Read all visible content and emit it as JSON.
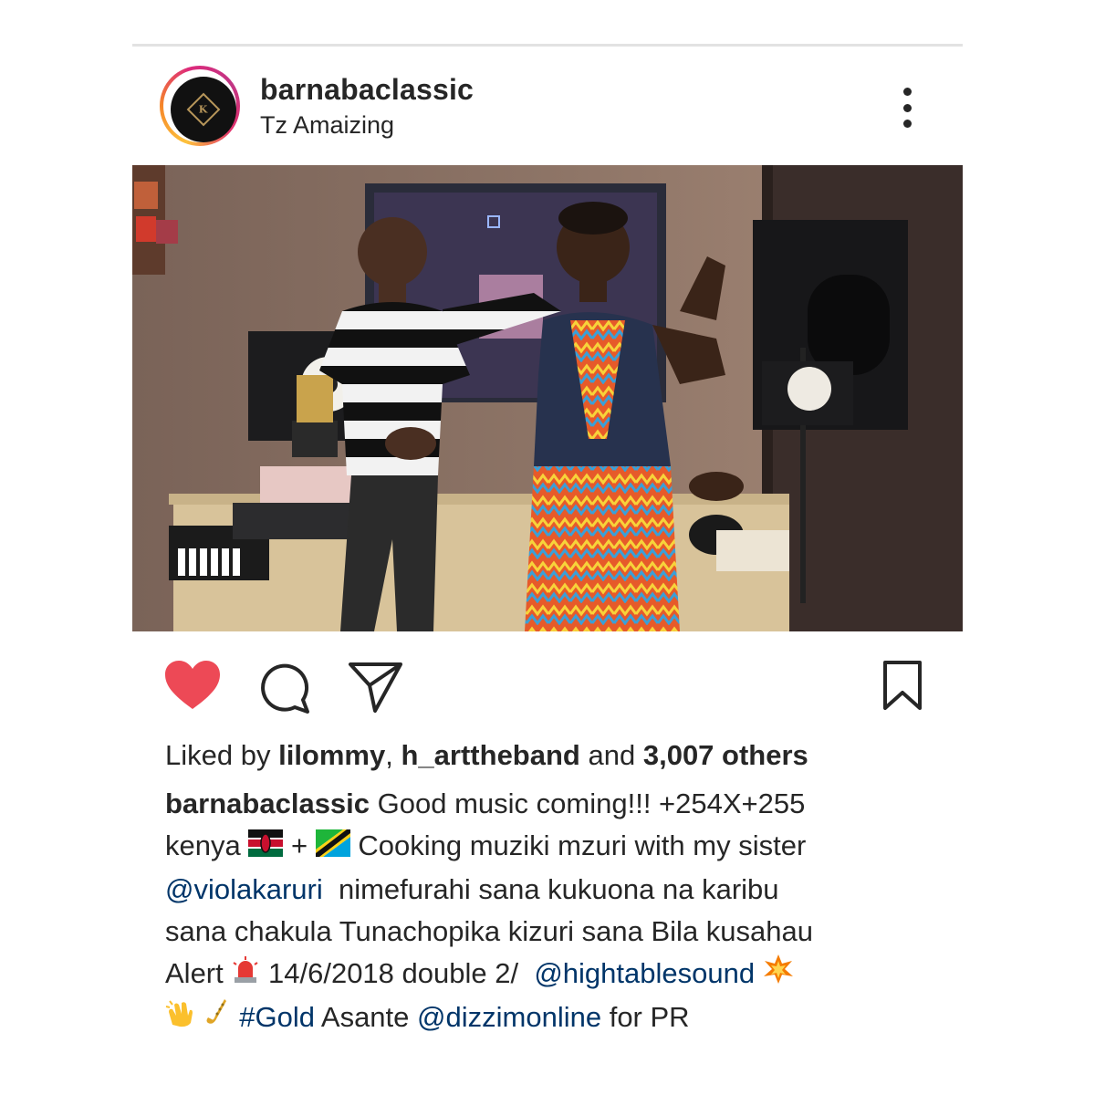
{
  "post": {
    "username": "barnabaclassic",
    "location": "Tz Amaizing",
    "avatar_monogram": "K"
  },
  "actions": {
    "like_icon": "heart-filled-icon",
    "comment_icon": "comment-icon",
    "share_icon": "send-icon",
    "save_icon": "bookmark-icon",
    "like_color": "#ed4956"
  },
  "likes": {
    "prefix": "Liked by",
    "user1": "lilommy",
    "sep": ",",
    "user2": "h_arttheband",
    "and": "and",
    "count": "3,007 others"
  },
  "caption": {
    "author": "barnabaclassic",
    "t1": "Good music coming!!! +254X+255",
    "t2": "kenya",
    "t3": "+",
    "t4": "Cooking muziki mzuri with my sister",
    "mention1": "@violakaruri",
    "t5": "nimefurahi sana kukuona na karibu",
    "t6": "sana chakula Tunachopika kizuri sana Bila kusahau",
    "t7": "Alert",
    "t8": "14/6/2018 double 2/",
    "mention2": "@hightablesound",
    "hashtag": "#Gold",
    "t9": "Asante",
    "mention3": "@dizzimonline",
    "t10": "for PR"
  },
  "colors": {
    "link": "#003569",
    "text": "#262626"
  }
}
